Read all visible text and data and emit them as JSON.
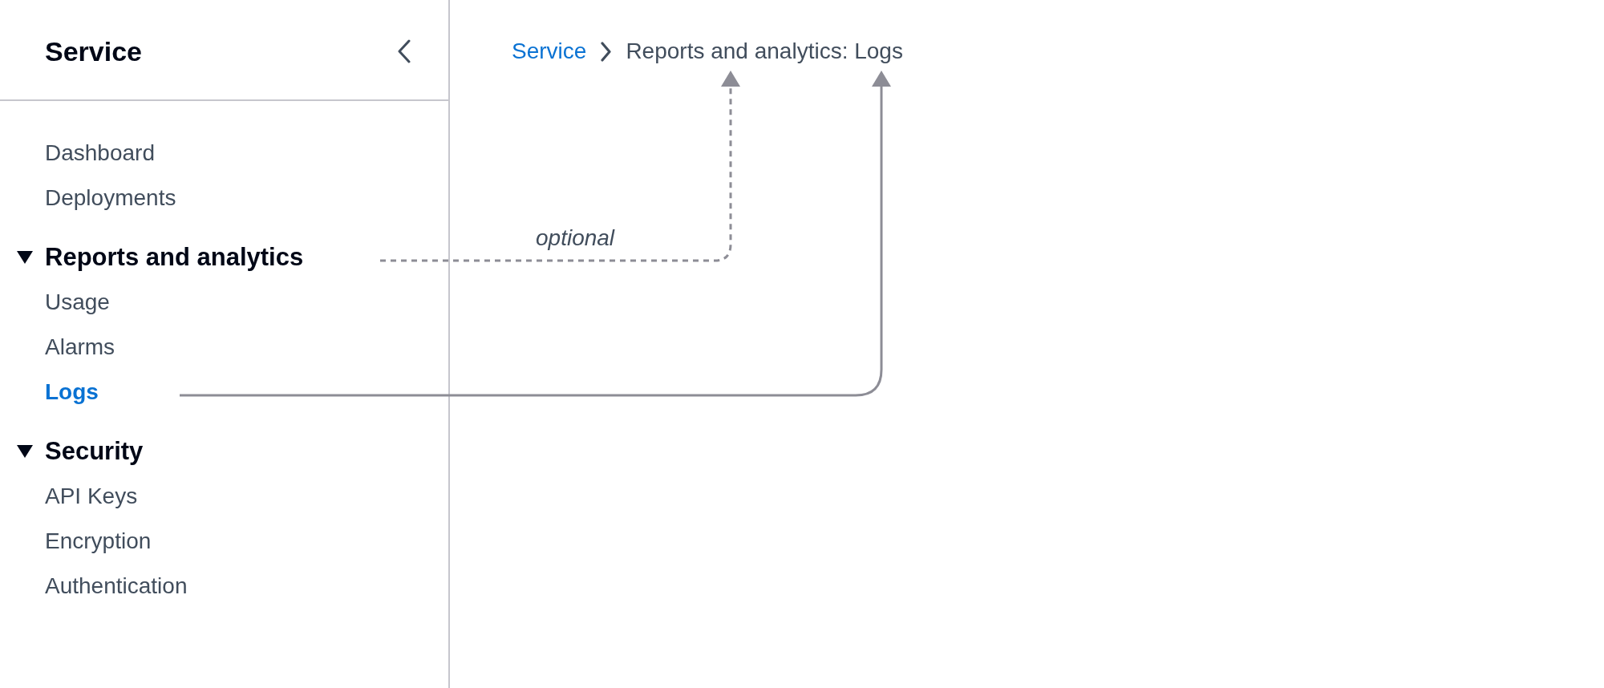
{
  "sidebar": {
    "title": "Service",
    "nav": [
      {
        "kind": "link",
        "label": "Dashboard",
        "selected": false
      },
      {
        "kind": "link",
        "label": "Deployments",
        "selected": false
      },
      {
        "kind": "section",
        "label": "Reports and analytics",
        "expanded": true,
        "children": [
          {
            "label": "Usage",
            "selected": false
          },
          {
            "label": "Alarms",
            "selected": false
          },
          {
            "label": "Logs",
            "selected": true
          }
        ]
      },
      {
        "kind": "section",
        "label": "Security",
        "expanded": true,
        "children": [
          {
            "label": "API Keys",
            "selected": false
          },
          {
            "label": "Encryption",
            "selected": false
          },
          {
            "label": "Authentication",
            "selected": false
          }
        ]
      }
    ]
  },
  "breadcrumb": {
    "items": [
      {
        "kind": "link",
        "label": "Service"
      },
      {
        "kind": "current",
        "label": "Reports and analytics: Logs"
      }
    ]
  },
  "annotations": [
    {
      "dashed": true,
      "label": "optional"
    },
    {
      "dashed": false
    }
  ]
}
